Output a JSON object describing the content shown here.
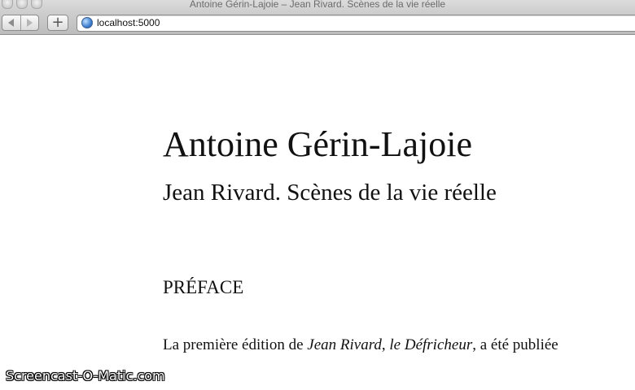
{
  "window": {
    "title": "Antoine Gérin-Lajoie – Jean Rivard. Scènes de la vie réelle"
  },
  "toolbar": {
    "back_icon": "back-arrow-icon",
    "forward_icon": "forward-arrow-icon",
    "new_tab_label": "+",
    "url": "localhost:5000"
  },
  "document": {
    "author": "Antoine Gérin-Lajoie",
    "title": "Jean Rivard. Scènes de la vie réelle",
    "section_heading": "PRÉFACE",
    "paragraph": {
      "part1": "La première édition de ",
      "book_title": "Jean Rivard",
      "part2": ", ",
      "subtitle": "le Défricheur",
      "part3": ", a été publiée"
    }
  },
  "watermark": "Screencast-O-Matic.com"
}
